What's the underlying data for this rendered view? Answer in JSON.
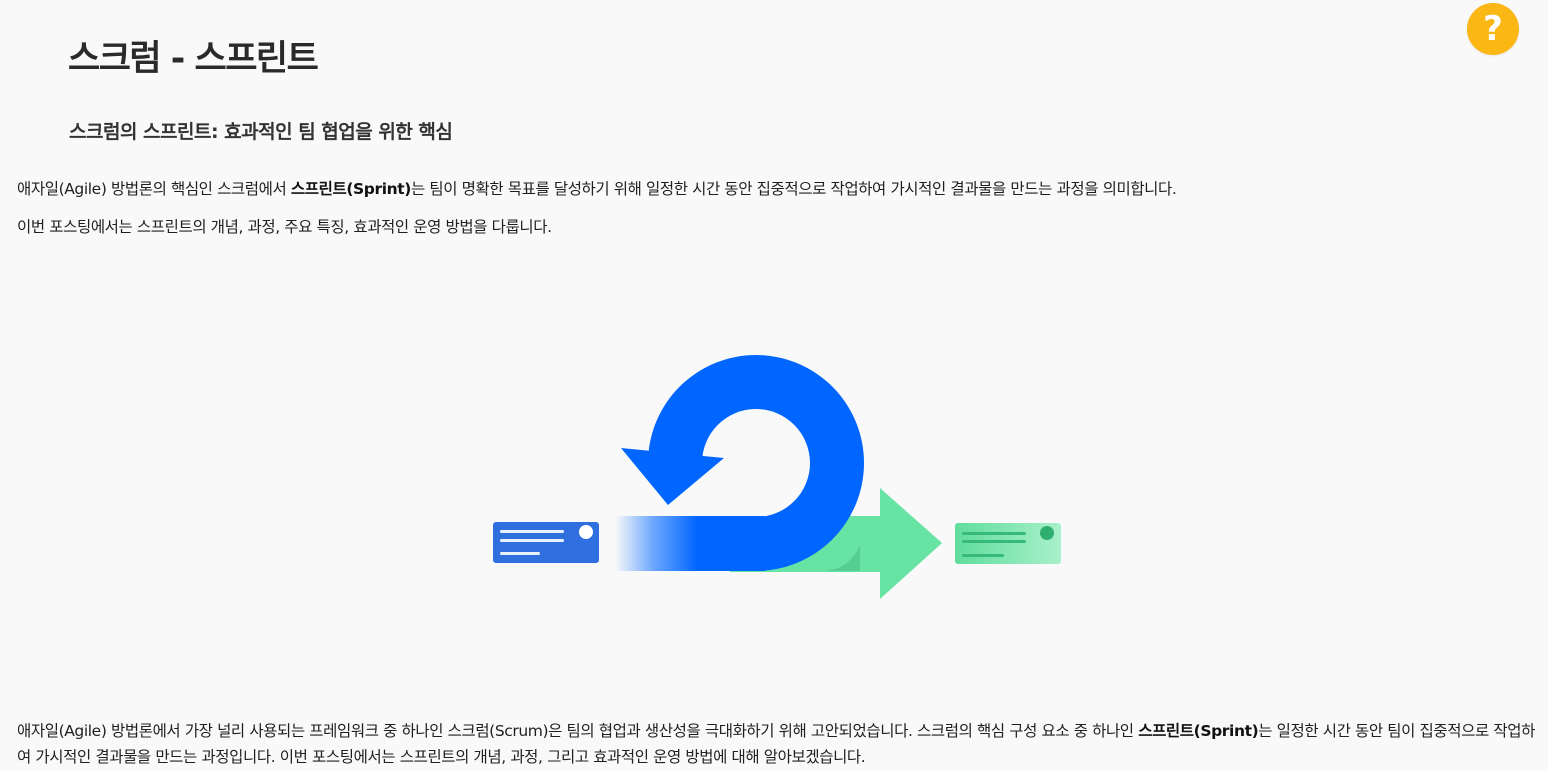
{
  "header": {
    "title": "스크럼 - 스프린트",
    "help_glyph": "?",
    "help_color": "#fbb714"
  },
  "subtitle": "스크럼의 스프린트: 효과적인 팀 협업을 위한 핵심",
  "intro": {
    "line1_pre": "애자일(Agile) 방법론의 핵심인 스크럼에서 ",
    "line1_bold": "스프린트(Sprint)",
    "line1_post": "는 팀이 명확한 목표를 달성하기 위해 일정한 시간 동안 집중적으로 작업하여 가시적인 결과물을 만드는 과정을 의미합니다.",
    "line2": "이번 포스팅에서는 스프린트의 개념, 과정, 주요 특징, 효과적인 운영 방법을 다룹니다."
  },
  "illustration": {
    "icon": "scrum-sprint-cycle-icon",
    "blue": "#0066ff",
    "green": "#67e3a4"
  },
  "body": {
    "pre": "애자일(Agile) 방법론에서 가장 널리 사용되는 프레임워크 중 하나인 스크럼(Scrum)은 팀의 협업과 생산성을 극대화하기 위해 고안되었습니다. 스크럼의 핵심 구성 요소 중 하나인 ",
    "bold": "스프린트(Sprint)",
    "post": "는 일정한 시간 동안 팀이 집중적으로 작업하여 가시적인 결과물을 만드는 과정입니다. 이번 포스팅에서는 스프린트의 개념, 과정, 그리고 효과적인 운영 방법에 대해 알아보겠습니다."
  }
}
